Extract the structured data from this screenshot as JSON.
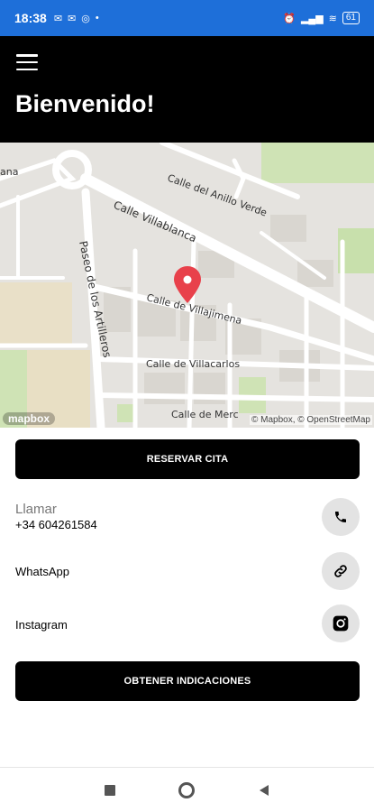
{
  "status_bar": {
    "time": "18:38",
    "left_icons": [
      "mail-icon",
      "mail-icon",
      "sync-icon",
      "dot-icon"
    ],
    "right_icons": [
      "alarm-icon",
      "signal-icon",
      "wifi-icon"
    ],
    "battery": "61"
  },
  "header": {
    "title": "Bienvenido!"
  },
  "map": {
    "streets": {
      "s1": "Calle del Anillo Verde",
      "s2": "Calle Villablanca",
      "s3": "Paseo de los Artilleros",
      "s4": "Calle de Villajimena",
      "s5": "Calle de Villacarlos",
      "s6": "Calle de Merc",
      "s7": "ana"
    },
    "attribution": "© Mapbox, © OpenStreetMap",
    "logo": "mapbox",
    "marker_color": "#e8414b"
  },
  "actions": {
    "reserve_label": "RESERVAR CITA",
    "directions_label": "OBTENER INDICACIONES"
  },
  "contacts": {
    "call_title": "Llamar",
    "call_number": "+34 604261584",
    "whatsapp_label": "WhatsApp",
    "instagram_label": "Instagram"
  },
  "colors": {
    "status_bar": "#1e6fd9",
    "header": "#000000",
    "button": "#000000",
    "circle_button": "#e3e3e3"
  }
}
